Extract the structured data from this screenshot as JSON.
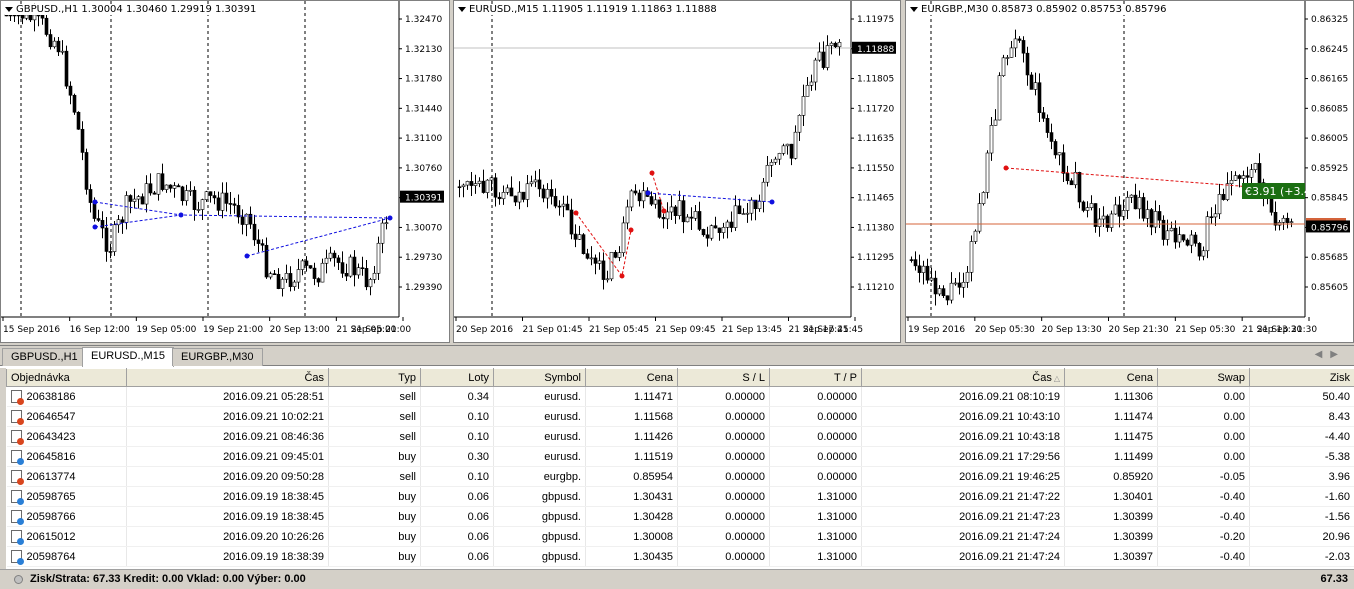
{
  "charts": [
    {
      "id": "gbpusd",
      "title": "GBPUSD.,H1  1.30004 1.30460 1.29919 1.30391",
      "prices": [
        "1.32470",
        "1.32130",
        "1.31780",
        "1.31440",
        "1.31100",
        "1.30760",
        "1.30391",
        "1.30070",
        "1.29730",
        "1.29390"
      ],
      "current_price": "1.30391",
      "times": [
        "15 Sep 2016",
        "16 Sep 12:00",
        "19 Sep 05:00",
        "19 Sep 21:00",
        "20 Sep 13:00",
        "21 Sep 05:00",
        "21 Sep 21:00"
      ]
    },
    {
      "id": "eurusd",
      "title": "EURUSD.,M15  1.11905 1.11919 1.11863 1.11888",
      "prices": [
        "1.11975",
        "1.11888",
        "1.11805",
        "1.11720",
        "1.11635",
        "1.11550",
        "1.11465",
        "1.11380",
        "1.11295",
        "1.11210"
      ],
      "current_price": "1.11888",
      "times": [
        "20 Sep 2016",
        "21 Sep 01:45",
        "21 Sep 05:45",
        "21 Sep 09:45",
        "21 Sep 13:45",
        "21 Sep 17:45",
        "21 Sep 21:45"
      ]
    },
    {
      "id": "eurgbp",
      "title": "EURGBP.,M30  0.85873 0.85902 0.85753 0.85796",
      "prices": [
        "0.86325",
        "0.86245",
        "0.86165",
        "0.86085",
        "0.86005",
        "0.85925",
        "0.85845",
        "0.85796",
        "0.85685",
        "0.85605"
      ],
      "current_price": "0.85796",
      "entry_price": "0.85817",
      "profit_label": "€3.91 (+3.4",
      "times": [
        "19 Sep 2016",
        "20 Sep 05:30",
        "20 Sep 13:30",
        "20 Sep 21:30",
        "21 Sep 05:30",
        "21 Sep 13:30",
        "21 Sep 21:30"
      ]
    }
  ],
  "chart_tabs": [
    "GBPUSD.,H1",
    "EURUSD.,M15",
    "EURGBP.,M30"
  ],
  "active_tab": 1,
  "table": {
    "headers": [
      "Objednávka",
      "Čas",
      "Typ",
      "Loty",
      "Symbol",
      "Cena",
      "S / L",
      "T / P",
      "Čas",
      "Cena",
      "Swap",
      "Zisk"
    ],
    "rows": [
      {
        "type": "sell",
        "cells": [
          "20638186",
          "2016.09.21 05:28:51",
          "sell",
          "0.34",
          "eurusd.",
          "1.11471",
          "0.00000",
          "0.00000",
          "2016.09.21 08:10:19",
          "1.11306",
          "0.00",
          "50.40"
        ]
      },
      {
        "type": "sell",
        "cells": [
          "20646547",
          "2016.09.21 10:02:21",
          "sell",
          "0.10",
          "eurusd.",
          "1.11568",
          "0.00000",
          "0.00000",
          "2016.09.21 10:43:10",
          "1.11474",
          "0.00",
          "8.43"
        ]
      },
      {
        "type": "sell",
        "cells": [
          "20643423",
          "2016.09.21 08:46:36",
          "sell",
          "0.10",
          "eurusd.",
          "1.11426",
          "0.00000",
          "0.00000",
          "2016.09.21 10:43:18",
          "1.11475",
          "0.00",
          "-4.40"
        ]
      },
      {
        "type": "buy",
        "cells": [
          "20645816",
          "2016.09.21 09:45:01",
          "buy",
          "0.30",
          "eurusd.",
          "1.11519",
          "0.00000",
          "0.00000",
          "2016.09.21 17:29:56",
          "1.11499",
          "0.00",
          "-5.38"
        ]
      },
      {
        "type": "sell",
        "cells": [
          "20613774",
          "2016.09.20 09:50:28",
          "sell",
          "0.10",
          "eurgbp.",
          "0.85954",
          "0.00000",
          "0.00000",
          "2016.09.21 19:46:25",
          "0.85920",
          "-0.05",
          "3.96"
        ]
      },
      {
        "type": "buy",
        "cells": [
          "20598765",
          "2016.09.19 18:38:45",
          "buy",
          "0.06",
          "gbpusd.",
          "1.30431",
          "0.00000",
          "1.31000",
          "2016.09.21 21:47:22",
          "1.30401",
          "-0.40",
          "-1.60"
        ]
      },
      {
        "type": "buy",
        "cells": [
          "20598766",
          "2016.09.19 18:38:45",
          "buy",
          "0.06",
          "gbpusd.",
          "1.30428",
          "0.00000",
          "1.31000",
          "2016.09.21 21:47:23",
          "1.30399",
          "-0.40",
          "-1.56"
        ]
      },
      {
        "type": "buy",
        "cells": [
          "20615012",
          "2016.09.20 10:26:26",
          "buy",
          "0.06",
          "gbpusd.",
          "1.30008",
          "0.00000",
          "1.31000",
          "2016.09.21 21:47:24",
          "1.30399",
          "-0.20",
          "20.96"
        ]
      },
      {
        "type": "buy",
        "cells": [
          "20598764",
          "2016.09.19 18:38:39",
          "buy",
          "0.06",
          "gbpusd.",
          "1.30435",
          "0.00000",
          "1.31000",
          "2016.09.21 21:47:24",
          "1.30397",
          "-0.40",
          "-2.03"
        ]
      }
    ]
  },
  "summary": {
    "text": "Zisk/Strata: 67.33  Kredit: 0.00  Vklad: 0.00  Výber: 0.00",
    "total": "67.33"
  },
  "colors": {
    "candle": "#000000",
    "sell_marker": "#e01010",
    "buy_marker": "#1010e0",
    "profit_label_bg": "#1b6e12",
    "entry_line": "#d4633a"
  }
}
